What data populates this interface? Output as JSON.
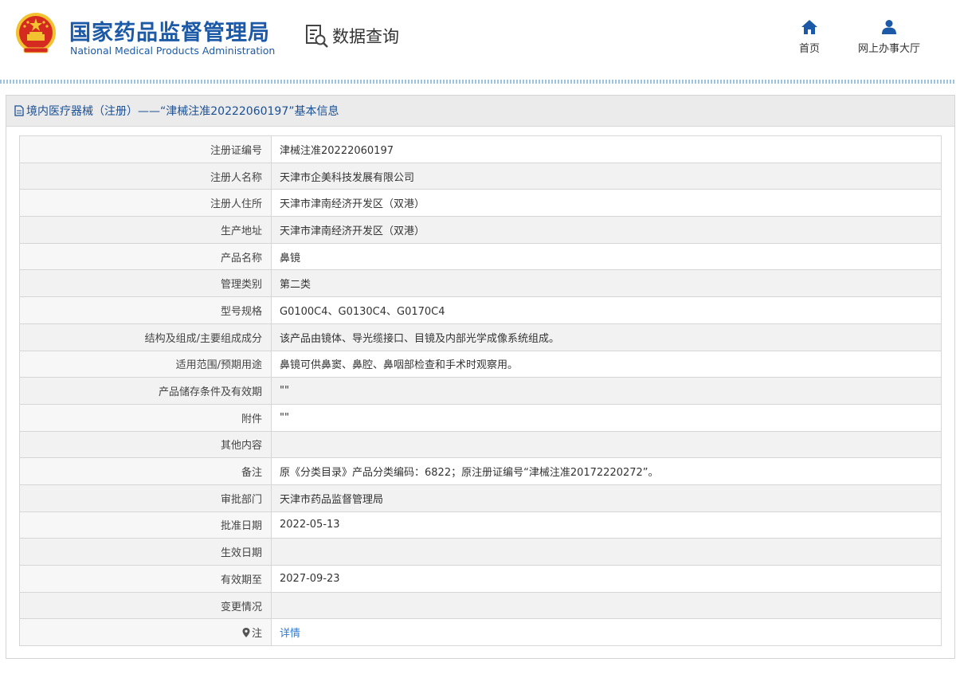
{
  "header": {
    "org_name_cn": "国家药品监督管理局",
    "org_name_en": "National Medical Products Administration",
    "data_query": "数据查询",
    "nav": {
      "home": "首页",
      "online_hall": "网上办事大厅"
    },
    "icons": {
      "emblem": "national-emblem-icon",
      "query": "search-document-icon",
      "home": "home-icon",
      "hall": "user-icon"
    }
  },
  "panel": {
    "title": "境内医疗器械（注册）——“津械注准20222060197”基本信息"
  },
  "fields": [
    {
      "label": "注册证编号",
      "value": "津械注准20222060197"
    },
    {
      "label": "注册人名称",
      "value": "天津市企美科技发展有限公司"
    },
    {
      "label": "注册人住所",
      "value": "天津市津南经济开发区（双港）"
    },
    {
      "label": "生产地址",
      "value": "天津市津南经济开发区（双港）"
    },
    {
      "label": "产品名称",
      "value": "鼻镜"
    },
    {
      "label": "管理类别",
      "value": "第二类"
    },
    {
      "label": "型号规格",
      "value": "G0100C4、G0130C4、G0170C4"
    },
    {
      "label": "结构及组成/主要组成成分",
      "value": "该产品由镜体、导光缆接口、目镜及内部光学成像系统组成。"
    },
    {
      "label": "适用范围/预期用途",
      "value": "鼻镜可供鼻窦、鼻腔、鼻咽部检查和手术时观察用。"
    },
    {
      "label": "产品储存条件及有效期",
      "value": "\"\""
    },
    {
      "label": "附件",
      "value": "\"\""
    },
    {
      "label": "其他内容",
      "value": ""
    },
    {
      "label": "备注",
      "value": "原《分类目录》产品分类编码：6822；原注册证编号“津械注准20172220272”。"
    },
    {
      "label": "审批部门",
      "value": "天津市药品监督管理局"
    },
    {
      "label": "批准日期",
      "value": "2022-05-13"
    },
    {
      "label": "生效日期",
      "value": ""
    },
    {
      "label": "有效期至",
      "value": "2027-09-23"
    },
    {
      "label": "变更情况",
      "value": ""
    },
    {
      "label": "注",
      "value": "详情"
    }
  ],
  "colors": {
    "brand_blue": "#1c5aa8",
    "title_blue": "#1b4f93",
    "link_blue": "#2f7ad1",
    "emblem_red": "#d42a1f",
    "emblem_gold": "#f2c230"
  }
}
